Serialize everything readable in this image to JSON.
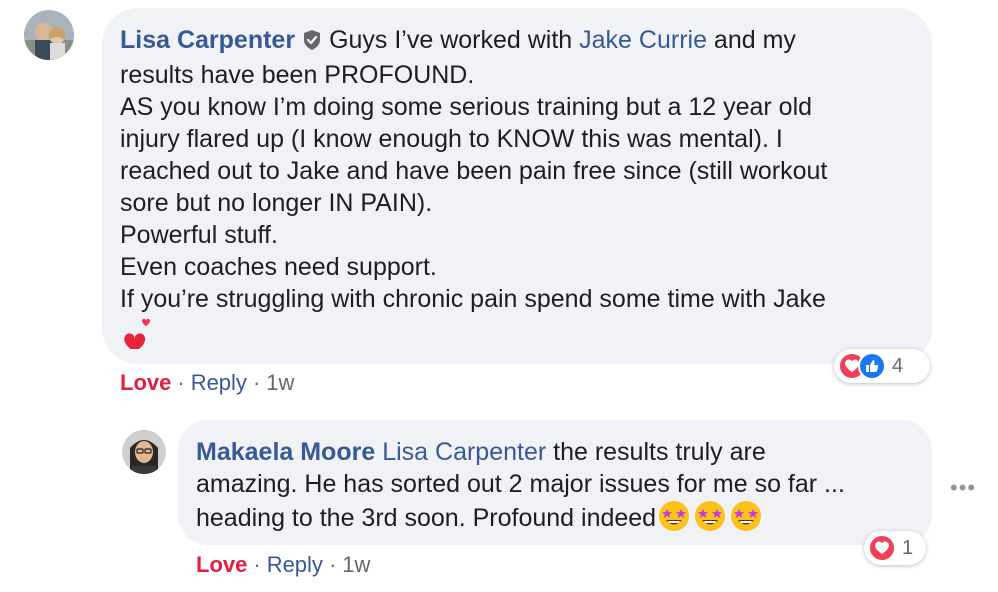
{
  "comment": {
    "author": "Lisa Carpenter",
    "lead_text": "Guys I’ve worked with",
    "mention": "Jake Currie",
    "lines": [
      " and my",
      "results have been PROFOUND.",
      "AS you know I’m doing some serious training but a 12 year old",
      "injury flared up (I know enough to KNOW this was mental). I",
      "reached out to Jake and have been pain free since (still workout",
      "sore but no longer IN PAIN).",
      "Powerful stuff.",
      "Even coaches need support.",
      "If you’re struggling with chronic pain spend some time with Jake"
    ],
    "reaction_count": "4",
    "actions": {
      "love": "Love",
      "reply": "Reply",
      "time": "1w",
      "dot": "·"
    }
  },
  "reply": {
    "author": "Makaela Moore",
    "mention": "Lisa Carpenter",
    "line1": " the results truly are",
    "line2": "amazing. He has sorted out 2 major issues for me so far ...",
    "line3": "heading to the 3rd soon. Profound indeed",
    "reaction_count": "1",
    "actions": {
      "love": "Love",
      "reply": "Reply",
      "time": "1w",
      "dot": "·"
    }
  },
  "more_options": "•••",
  "colors": {
    "link": "#385898",
    "love": "#e41e3f",
    "bubble": "#f0f2f5",
    "like_blue": "#1877f2"
  },
  "icons": [
    "verified-badge-icon",
    "sparkling-heart-icon",
    "heart-reaction-icon",
    "like-reaction-icon",
    "star-struck-emoji-icon",
    "more-options-icon"
  ]
}
